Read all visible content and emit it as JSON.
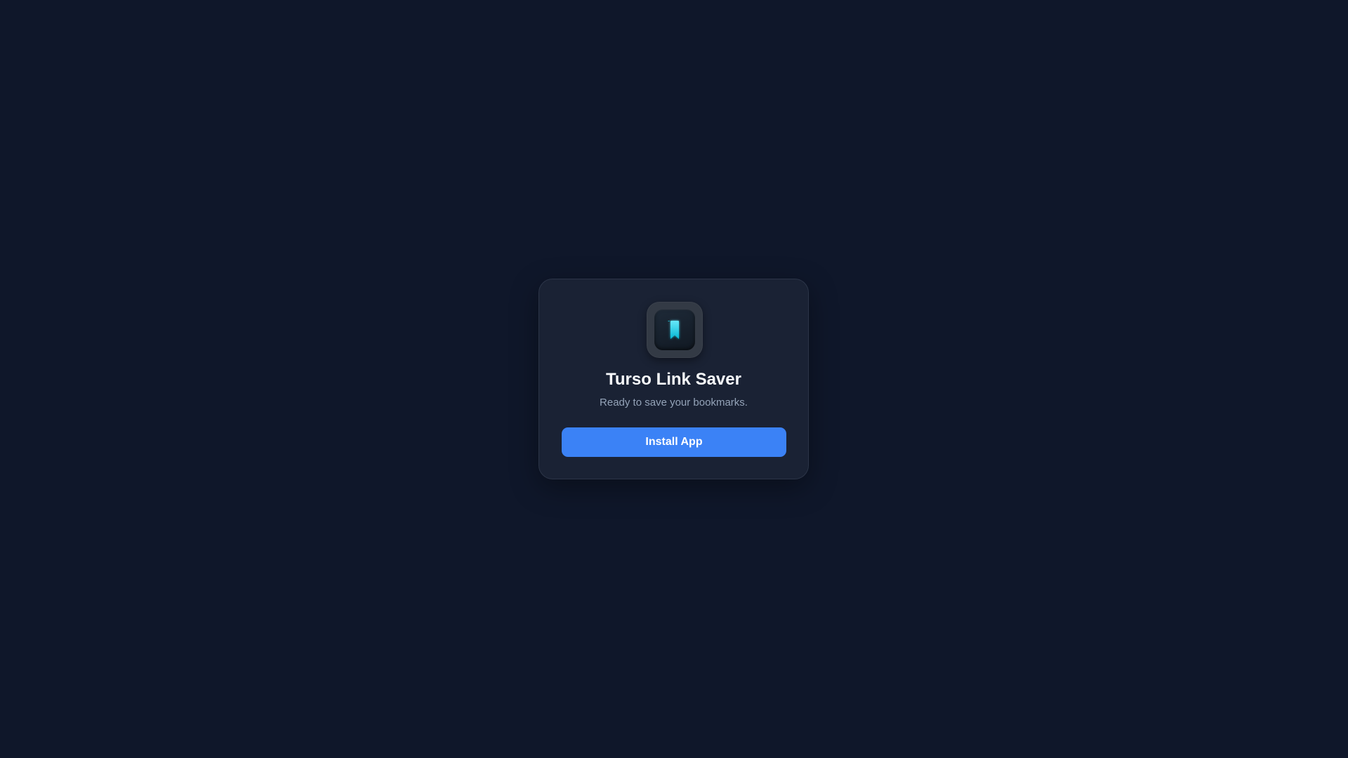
{
  "app": {
    "title": "Turso Link Saver",
    "subtitle": "Ready to save your bookmarks.",
    "icon": "bookmark-icon"
  },
  "actions": {
    "install_label": "Install App"
  },
  "colors": {
    "background": "#0f172a",
    "card": "#1a2234",
    "accent": "#3b82f6",
    "icon_glow": "#22d3ee"
  }
}
